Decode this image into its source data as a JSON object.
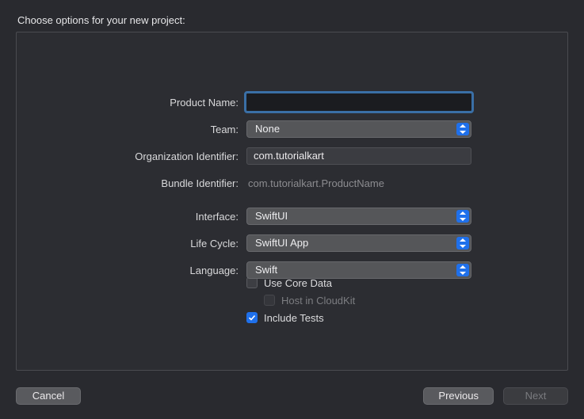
{
  "title": "Choose options for your new project:",
  "form": {
    "product_name_label": "Product Name:",
    "product_name_value": "",
    "team_label": "Team:",
    "team_value": "None",
    "org_id_label": "Organization Identifier:",
    "org_id_value": "com.tutorialkart",
    "bundle_id_label": "Bundle Identifier:",
    "bundle_id_value": "com.tutorialkart.ProductName",
    "interface_label": "Interface:",
    "interface_value": "SwiftUI",
    "lifecycle_label": "Life Cycle:",
    "lifecycle_value": "SwiftUI App",
    "language_label": "Language:",
    "language_value": "Swift",
    "core_data_label": "Use Core Data",
    "cloudkit_label": "Host in CloudKit",
    "include_tests_label": "Include Tests"
  },
  "footer": {
    "cancel": "Cancel",
    "previous": "Previous",
    "next": "Next"
  }
}
